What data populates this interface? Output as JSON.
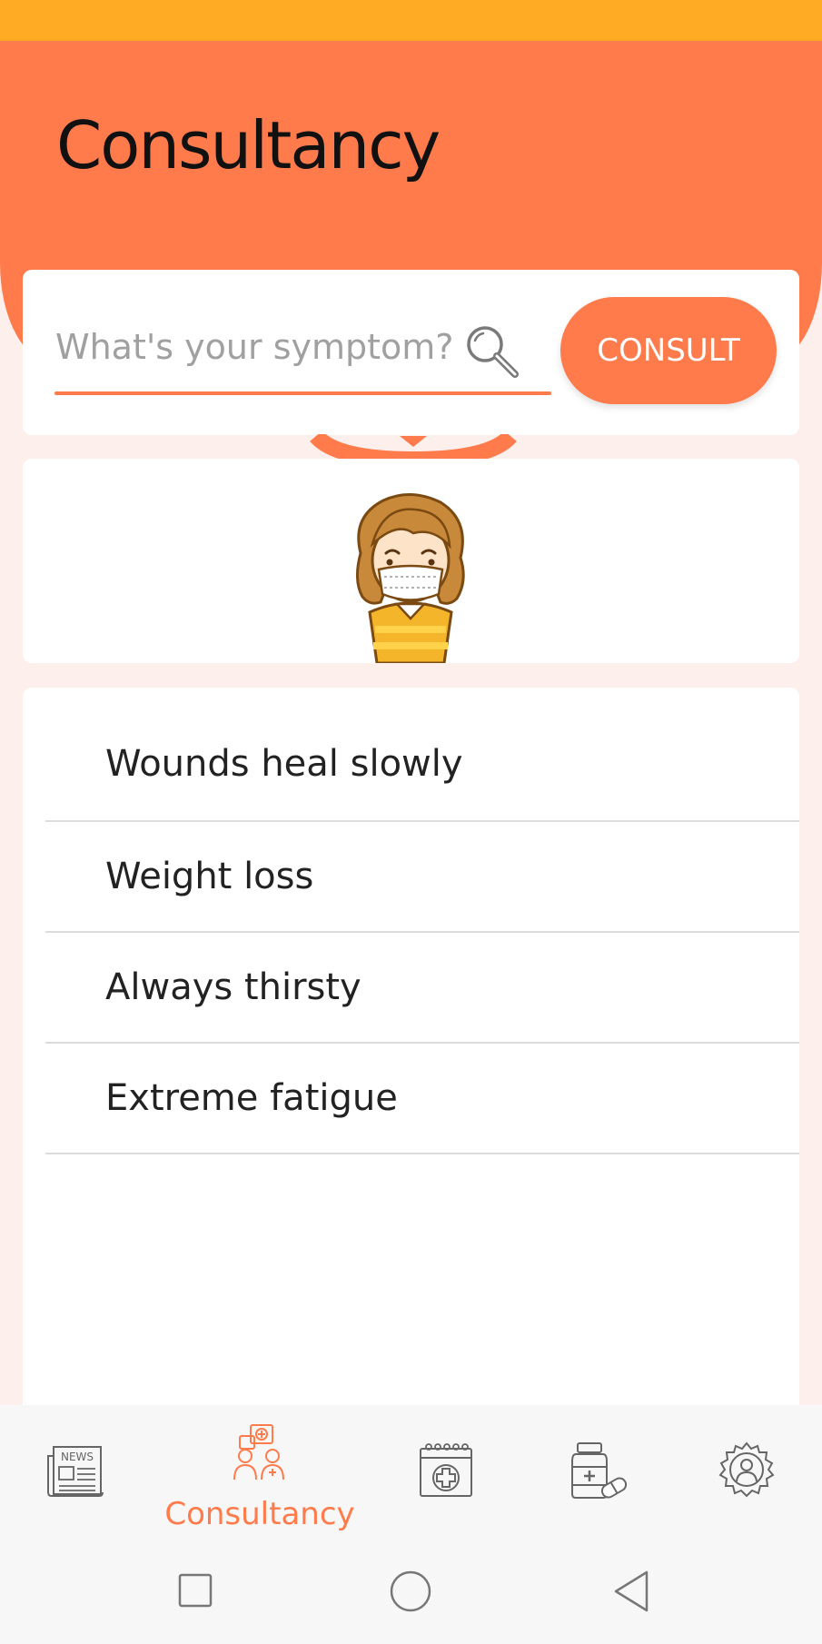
{
  "header": {
    "title": "Consultancy"
  },
  "search": {
    "placeholder": "What's your symptom?",
    "button_label": "CONSULT"
  },
  "symptoms": [
    {
      "label": "Wounds heal slowly"
    },
    {
      "label": "Weight loss"
    },
    {
      "label": "Always thirsty"
    },
    {
      "label": "Extreme fatigue"
    }
  ],
  "bottom_nav": {
    "items": [
      {
        "icon": "news-icon",
        "label": ""
      },
      {
        "icon": "doctors-icon",
        "label": "Consultancy",
        "active": true
      },
      {
        "icon": "medical-calendar-icon",
        "label": ""
      },
      {
        "icon": "medicine-icon",
        "label": ""
      },
      {
        "icon": "settings-user-icon",
        "label": ""
      }
    ],
    "news_icon_text": "NEWS"
  },
  "colors": {
    "accent": "#ff7b4c",
    "status_bar": "#ffab23",
    "background": "#fdf0ec"
  }
}
